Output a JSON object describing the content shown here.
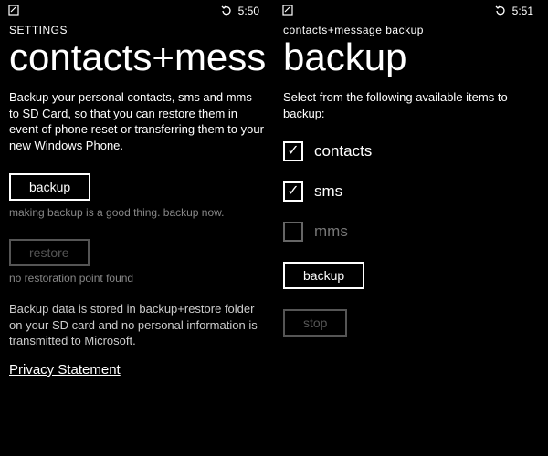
{
  "left": {
    "status": {
      "time": "5:50"
    },
    "header_small": "SETTINGS",
    "header_large": "contacts+message backup",
    "intro": "Backup your personal contacts, sms and mms to SD Card, so that you can restore them in event of phone reset or transferring them to your new Windows Phone.",
    "backup_btn": "backup",
    "backup_hint": "making backup is a good thing. backup now.",
    "restore_btn": "restore",
    "restore_hint": "no restoration point found",
    "footer_note": "Backup data is stored in backup+restore folder on your SD card and no personal information is transmitted to Microsoft.",
    "privacy_link": "Privacy Statement"
  },
  "right": {
    "status": {
      "time": "5:51"
    },
    "header_small": "contacts+message backup",
    "header_large": "backup",
    "intro": "Select from the following available items to backup:",
    "items": [
      {
        "label": "contacts",
        "checked": true,
        "enabled": true
      },
      {
        "label": "sms",
        "checked": true,
        "enabled": true
      },
      {
        "label": "mms",
        "checked": false,
        "enabled": false
      }
    ],
    "backup_btn": "backup",
    "stop_btn": "stop"
  }
}
